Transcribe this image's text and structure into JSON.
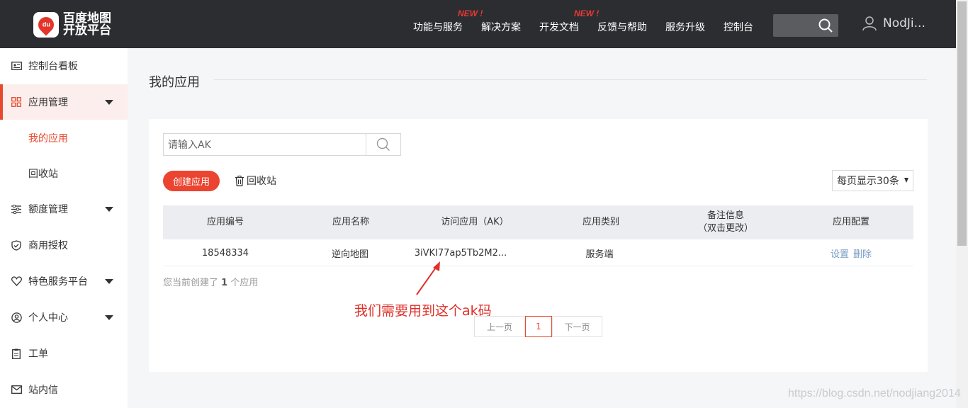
{
  "header": {
    "logo_badge": "du",
    "logo_line1": "百度地图",
    "logo_line2": "开放平台",
    "nav": [
      {
        "label": "功能与服务",
        "new": ""
      },
      {
        "label": "解决方案",
        "new": "NEW !"
      },
      {
        "label": "开发文档",
        "new": ""
      },
      {
        "label": "反馈与帮助",
        "new": "NEW !"
      },
      {
        "label": "服务升级",
        "new": ""
      },
      {
        "label": "控制台",
        "new": ""
      }
    ],
    "username": "NodJi..."
  },
  "sidebar": {
    "items": [
      {
        "label": "控制台看板",
        "icon": "id-card-icon"
      },
      {
        "label": "应用管理",
        "icon": "grid-icon"
      },
      {
        "label": "额度管理",
        "icon": "sliders-icon"
      },
      {
        "label": "商用授权",
        "icon": "shield-check-icon"
      },
      {
        "label": "特色服务平台",
        "icon": "heart-icon"
      },
      {
        "label": "个人中心",
        "icon": "user-circle-icon"
      },
      {
        "label": "工单",
        "icon": "clipboard-icon"
      },
      {
        "label": "站内信",
        "icon": "mail-icon"
      }
    ],
    "subitems": [
      "我的应用",
      "回收站"
    ]
  },
  "main": {
    "title": "我的应用",
    "search_placeholder": "请输入AK",
    "create_button": "创建应用",
    "recycle_button": "回收站",
    "per_page": "每页显示30条",
    "table": {
      "headers": [
        "应用编号",
        "应用名称",
        "访问应用（AK）",
        "应用类别",
        "备注信息",
        "（双击更改）",
        "应用配置"
      ],
      "rows": [
        {
          "id": "18548334",
          "name": "逆向地图",
          "ak": "3iVKI77ap5Tb2M2...",
          "type": "服务端",
          "note": "",
          "settings": "设置",
          "delete": "删除"
        }
      ]
    },
    "summary_prefix": "您当前创建了",
    "summary_count": "1",
    "summary_suffix": "个应用",
    "annotation": "我们需要用到这个ak码",
    "pager": {
      "prev": "上一页",
      "current": "1",
      "next": "下一页"
    }
  },
  "watermark": "https://blog.csdn.net/nodjiang2014",
  "colors": {
    "accent": "#eb4430",
    "topbar": "#2c2d31",
    "link": "#7a9cc4"
  }
}
